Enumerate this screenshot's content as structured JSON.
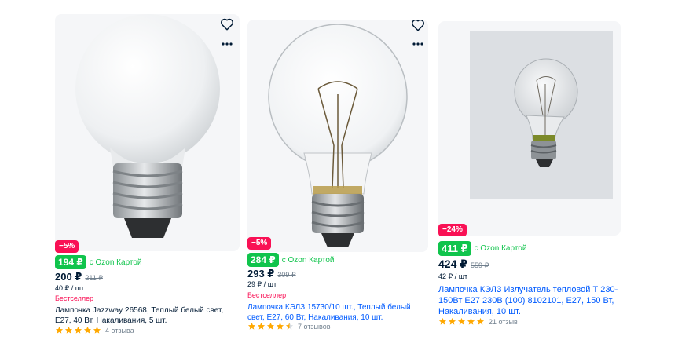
{
  "colors": {
    "accent_green": "#10c44c",
    "discount_red": "#f91155",
    "link_blue": "#005bff",
    "star_yellow": "#ffa800",
    "star_empty": "#d6dbe0"
  },
  "products": [
    {
      "discount": "−5%",
      "ozon_price": "194 ₽",
      "ozon_label": "с Ozon Картой",
      "price": "200 ₽",
      "old_price": "211 ₽",
      "per_unit": "40 ₽ / шт",
      "bestseller": "Бестселлер",
      "title": "Лампочка Jazzway 26568, Теплый белый свет, E27, 40 Вт, Накаливания, 5 шт.",
      "rating": 5,
      "reviews": "4 отзыва",
      "icons": {
        "favorite": "heart-icon",
        "more": "more-dots-icon"
      }
    },
    {
      "discount": "−5%",
      "ozon_price": "284 ₽",
      "ozon_label": "с Ozon Картой",
      "price": "293 ₽",
      "old_price": "309 ₽",
      "per_unit": "29 ₽ / шт",
      "bestseller": "Бестселлер",
      "title": "Лампочка КЭЛЗ 15730/10 шт., Теплый белый свет, E27, 60 Вт, Накаливания, 10 шт.",
      "rating": 4.5,
      "reviews": "7 отзывов",
      "icons": {
        "favorite": "heart-icon",
        "more": "more-dots-icon"
      }
    },
    {
      "discount": "−24%",
      "ozon_price": "411 ₽",
      "ozon_label": "с Ozon Картой",
      "price": "424 ₽",
      "old_price": "559 ₽",
      "per_unit": "42 ₽ / шт",
      "title": "Лампочка КЭЛЗ Излучатель тепловой Т 230-150Вт Е27 230В (100) 8102101, E27, 150 Вт, Накаливания, 10 шт.",
      "rating": 5,
      "reviews": "21 отзыв"
    }
  ]
}
